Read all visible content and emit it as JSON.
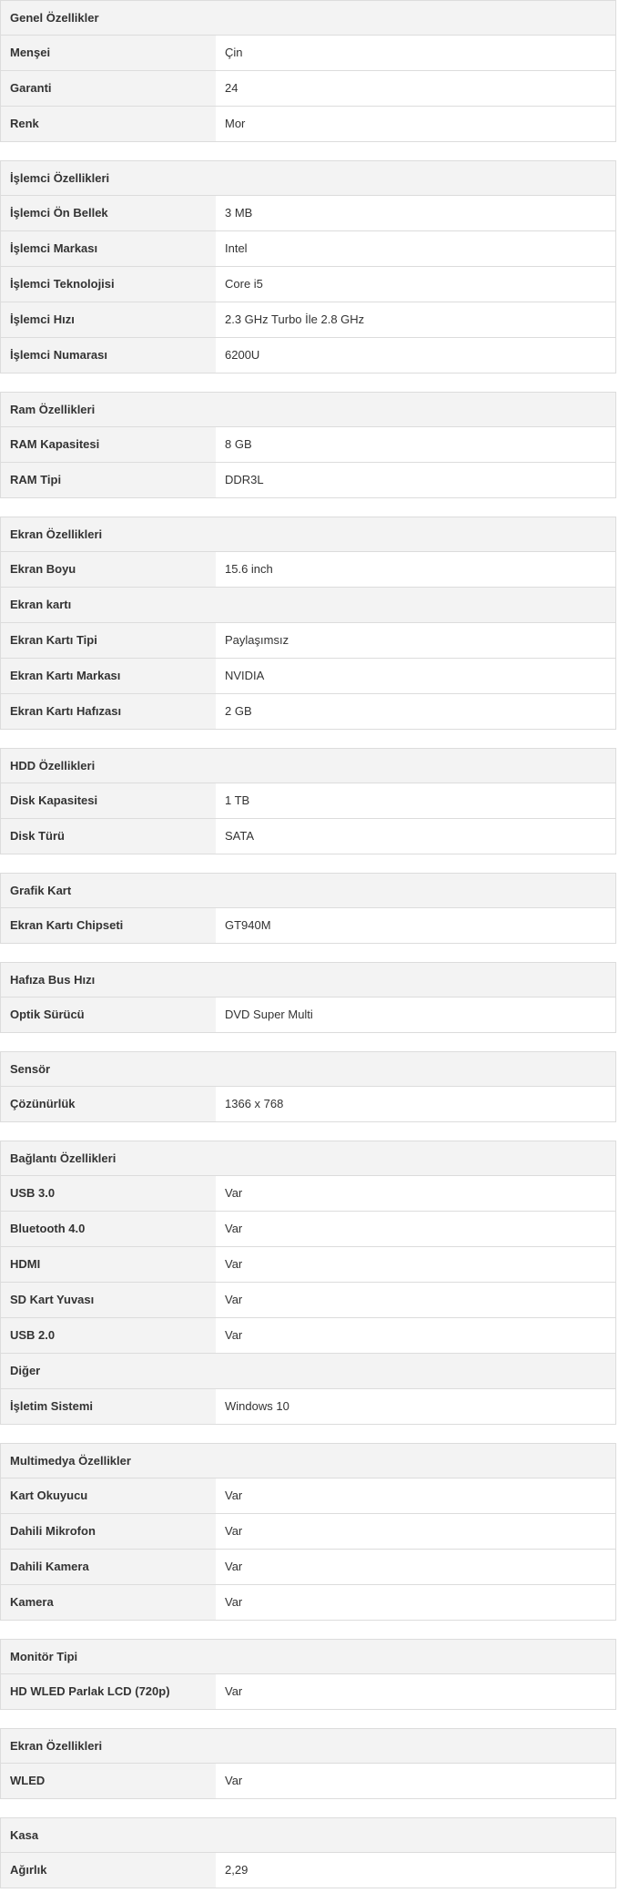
{
  "sections": [
    {
      "title": "Genel Özellikler",
      "rows": [
        {
          "label": "Menşei",
          "value": "Çin"
        },
        {
          "label": "Garanti",
          "value": "24"
        },
        {
          "label": "Renk",
          "value": "Mor"
        }
      ]
    },
    {
      "title": "İşlemci Özellikleri",
      "rows": [
        {
          "label": "İşlemci Ön Bellek",
          "value": "3 MB"
        },
        {
          "label": "İşlemci Markası",
          "value": "Intel"
        },
        {
          "label": "İşlemci Teknolojisi",
          "value": "Core i5"
        },
        {
          "label": "İşlemci Hızı",
          "value": "2.3 GHz Turbo İle 2.8 GHz"
        },
        {
          "label": "İşlemci Numarası",
          "value": "6200U"
        }
      ]
    },
    {
      "title": "Ram Özellikleri",
      "rows": [
        {
          "label": "RAM Kapasitesi",
          "value": "8 GB"
        },
        {
          "label": "RAM Tipi",
          "value": "DDR3L"
        }
      ]
    },
    {
      "title": "Ekran Özellikleri",
      "rows": [
        {
          "label": "Ekran Boyu",
          "value": "15.6 inch"
        },
        {
          "label": "Ekran kartı",
          "subheader": true
        },
        {
          "label": "Ekran Kartı Tipi",
          "value": "Paylaşımsız"
        },
        {
          "label": "Ekran Kartı Markası",
          "value": "NVIDIA"
        },
        {
          "label": "Ekran Kartı Hafızası",
          "value": "2 GB"
        }
      ]
    },
    {
      "title": "HDD Özellikleri",
      "rows": [
        {
          "label": "Disk Kapasitesi",
          "value": "1 TB"
        },
        {
          "label": "Disk Türü",
          "value": "SATA"
        }
      ]
    },
    {
      "title": "Grafik Kart",
      "rows": [
        {
          "label": "Ekran Kartı Chipseti",
          "value": "GT940M"
        }
      ]
    },
    {
      "title": "Hafıza Bus Hızı",
      "rows": [
        {
          "label": "Optik Sürücü",
          "value": "DVD Super Multi"
        }
      ]
    },
    {
      "title": "Sensör",
      "rows": [
        {
          "label": "Çözünürlük",
          "value": "1366 x 768"
        }
      ]
    },
    {
      "title": "Bağlantı Özellikleri",
      "rows": [
        {
          "label": "USB 3.0",
          "value": "Var"
        },
        {
          "label": "Bluetooth 4.0",
          "value": "Var"
        },
        {
          "label": "HDMI",
          "value": "Var"
        },
        {
          "label": "SD Kart Yuvası",
          "value": "Var"
        },
        {
          "label": "USB 2.0",
          "value": "Var"
        },
        {
          "label": "Diğer",
          "subheader": true
        },
        {
          "label": "İşletim Sistemi",
          "value": "Windows 10"
        }
      ]
    },
    {
      "title": "Multimedya Özellikler",
      "rows": [
        {
          "label": "Kart Okuyucu",
          "value": "Var"
        },
        {
          "label": "Dahili Mikrofon",
          "value": "Var"
        },
        {
          "label": "Dahili Kamera",
          "value": "Var"
        },
        {
          "label": "Kamera",
          "value": "Var"
        }
      ]
    },
    {
      "title": "Monitör Tipi",
      "rows": [
        {
          "label": "HD WLED Parlak LCD (720p)",
          "value": "Var"
        }
      ]
    },
    {
      "title": "Ekran Özellikleri",
      "rows": [
        {
          "label": "WLED",
          "value": "Var"
        }
      ]
    },
    {
      "title": "Kasa",
      "rows": [
        {
          "label": "Ağırlık",
          "value": "2,29"
        }
      ]
    }
  ]
}
